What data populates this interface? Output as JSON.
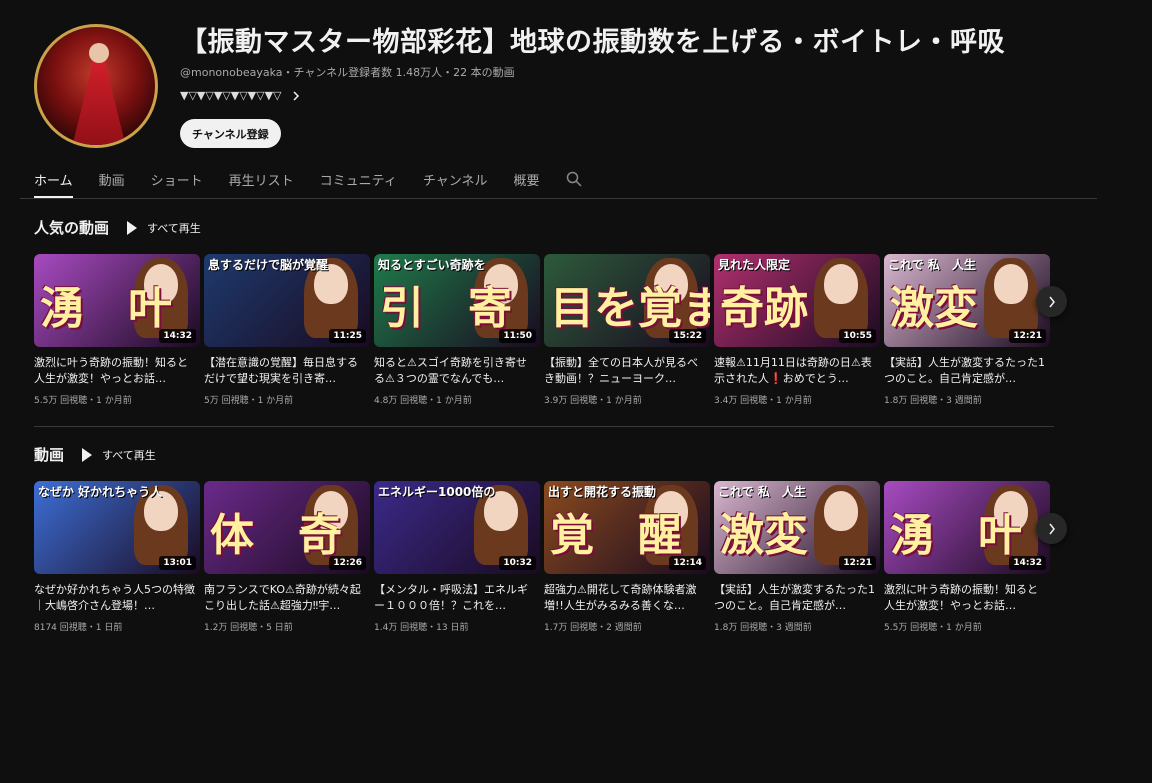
{
  "channel": {
    "title": "【振動マスター物部彩花】地球の振動数を上げる・ボイトレ・呼吸",
    "meta": "@mononobeayaka・チャンネル登録者数 1.48万人・22 本の動画",
    "description": "▼▽▼▽▼▽▼▽▼▽▼▽",
    "subscribe_label": "チャンネル登録"
  },
  "tabs": [
    "ホーム",
    "動画",
    "ショート",
    "再生リスト",
    "コミュニティ",
    "チャンネル",
    "概要"
  ],
  "colors": {
    "background": "#0f0f0f",
    "text": "#f1f1f1",
    "muted": "#aaaaaa"
  },
  "sections": [
    {
      "title": "人気の動画",
      "play_all": "すべて再生",
      "videos": [
        {
          "duration": "14:32",
          "title": "激烈に叶う奇跡の振動！知ると人生が激変！やっとお話…",
          "meta": "5.5万 回視聴・1 か月前",
          "thumb_text": "湧　叶",
          "thumb_caption": "",
          "bg": "#a84bc1"
        },
        {
          "duration": "11:25",
          "title": "【潜在意識の覚醒】毎日息するだけで望む現実を引き寄…",
          "meta": "5万 回視聴・1 か月前",
          "thumb_text": "",
          "thumb_caption": "息するだけで脳が覚醒",
          "bg": "#1e3a6e"
        },
        {
          "duration": "11:50",
          "title": "知ると⚠スゴイ奇跡を引き寄せる⚠３つの霊でなんでも…",
          "meta": "4.8万 回視聴・1 か月前",
          "thumb_text": "引　寄",
          "thumb_caption": "知るとすごい奇跡を",
          "bg": "#1f7a4a"
        },
        {
          "duration": "15:22",
          "title": "【振動】全ての日本人が見るべき動画！？ニューヨーク…",
          "meta": "3.9万 回視聴・1 か月前",
          "thumb_text": "目を覚ませ",
          "thumb_caption": "",
          "bg": "#2d5a3a"
        },
        {
          "duration": "10:55",
          "title": "速報⚠11月11日は奇跡の日⚠表示された人❗おめでとう…",
          "meta": "3.4万 回視聴・1 か月前",
          "thumb_text": "奇跡",
          "thumb_caption": "見れた人限定",
          "bg": "#b0306e"
        },
        {
          "duration": "12:21",
          "title": "【実話】人生が激変するたった1つのこと。自己肯定感が…",
          "meta": "1.8万 回視聴・3 週間前",
          "thumb_text": "激変",
          "thumb_caption": "これで 私　人生",
          "bg": "#d9b6cf"
        }
      ]
    },
    {
      "title": "動画",
      "play_all": "すべて再生",
      "videos": [
        {
          "duration": "13:01",
          "title": "なぜか好かれちゃう人5つの特徴｜大嶋啓介さん登場！…",
          "meta": "8174 回視聴・1 日前",
          "thumb_text": "",
          "thumb_caption": "なぜか 好かれちゃう人",
          "bg": "#3d6fd6"
        },
        {
          "duration": "12:26",
          "title": "南フランスでKO⚠奇跡が続々起こり出した話⚠超強力‼宇…",
          "meta": "1.2万 回視聴・5 日前",
          "thumb_text": "体　奇",
          "thumb_caption": "",
          "bg": "#6b2a8a"
        },
        {
          "duration": "10:32",
          "title": "【メンタル・呼吸法】エネルギー１０００倍！？これを…",
          "meta": "1.4万 回視聴・13 日前",
          "thumb_text": "",
          "thumb_caption": "エネルギー1000倍の",
          "bg": "#3b2a8a"
        },
        {
          "duration": "12:14",
          "title": "超強力⚠開花して奇跡体験者激増!!人生がみるみる善くな…",
          "meta": "1.7万 回視聴・2 週間前",
          "thumb_text": "覚　醒",
          "thumb_caption": "出すと開花する振動",
          "bg": "#8a4a1e"
        },
        {
          "duration": "12:21",
          "title": "【実話】人生が激変するたった1つのこと。自己肯定感が…",
          "meta": "1.8万 回視聴・3 週間前",
          "thumb_text": "激変",
          "thumb_caption": "これで 私　人生",
          "bg": "#d9b6cf"
        },
        {
          "duration": "14:32",
          "title": "激烈に叶う奇跡の振動！知ると人生が激変！やっとお話…",
          "meta": "5.5万 回視聴・1 か月前",
          "thumb_text": "湧　叶",
          "thumb_caption": "",
          "bg": "#a84bc1"
        }
      ]
    }
  ]
}
